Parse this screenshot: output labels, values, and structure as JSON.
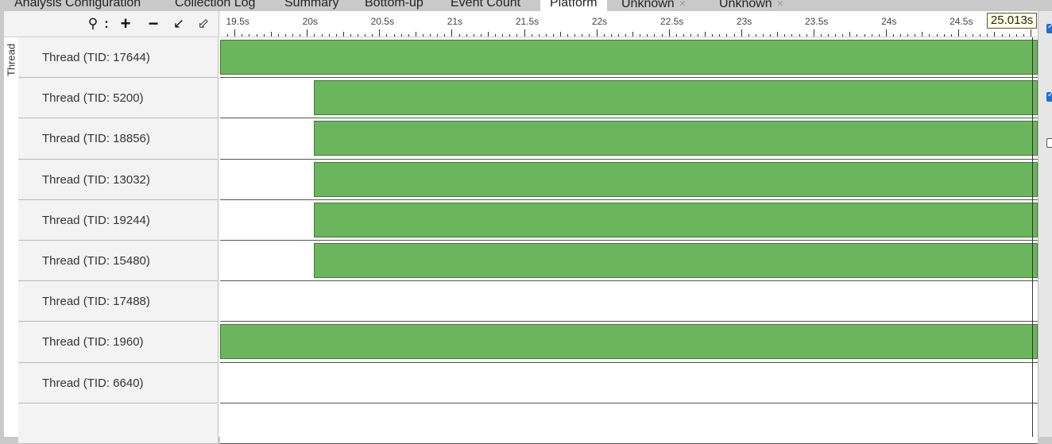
{
  "tabs": [
    {
      "label": "Analysis Configuration",
      "closable": false,
      "active": false
    },
    {
      "label": "Collection Log",
      "closable": false,
      "active": false
    },
    {
      "label": "Summary",
      "closable": false,
      "active": false
    },
    {
      "label": "Bottom-up",
      "closable": false,
      "active": false
    },
    {
      "label": "Event Count",
      "closable": false,
      "active": false
    },
    {
      "label": "Platform",
      "closable": false,
      "active": true
    },
    {
      "label": "Unknown",
      "closable": true,
      "active": false
    },
    {
      "label": "Unknown",
      "closable": true,
      "active": false
    }
  ],
  "toolbar": {
    "icons": [
      "search-icon",
      "menu-dots-icon",
      "zoom-in-icon",
      "zoom-out-icon",
      "undo-zoom-icon",
      "reset-zoom-icon"
    ]
  },
  "timeline": {
    "start_s": 19.4,
    "end_s": 25.05,
    "ticks": [
      "19.5s",
      "20s",
      "20.5s",
      "21s",
      "21.5s",
      "22s",
      "22.5s",
      "23s",
      "23.5s",
      "24s",
      "24.5s"
    ],
    "cursor_label": "25.013s",
    "cursor_s": 25.013
  },
  "thread_group_label": "Thread",
  "threads": [
    {
      "label": "Thread (TID: 17644)",
      "busy_start_s": 19.4,
      "busy_end_s": 25.09
    },
    {
      "label": "Thread (TID: 5200)",
      "busy_start_s": 20.05,
      "busy_end_s": 25.09
    },
    {
      "label": "Thread (TID: 18856)",
      "busy_start_s": 20.05,
      "busy_end_s": 25.09
    },
    {
      "label": "Thread (TID: 13032)",
      "busy_start_s": 20.05,
      "busy_end_s": 25.09
    },
    {
      "label": "Thread (TID: 19244)",
      "busy_start_s": 20.05,
      "busy_end_s": 25.09
    },
    {
      "label": "Thread (TID: 15480)",
      "busy_start_s": 20.05,
      "busy_end_s": 25.09
    },
    {
      "label": "Thread (TID: 17488)",
      "busy_start_s": null,
      "busy_end_s": null
    },
    {
      "label": "Thread (TID: 1960)",
      "busy_start_s": 19.4,
      "busy_end_s": 25.09
    },
    {
      "label": "Thread (TID: 6640)",
      "busy_start_s": null,
      "busy_end_s": null
    },
    {
      "label": "",
      "busy_start_s": null,
      "busy_end_s": null
    }
  ],
  "right_checkboxes": [
    true,
    true,
    false
  ],
  "colors": {
    "bar_fill": "#6bb55c",
    "bar_border": "#3f7d33",
    "cursor_bg": "#ffffe1"
  }
}
